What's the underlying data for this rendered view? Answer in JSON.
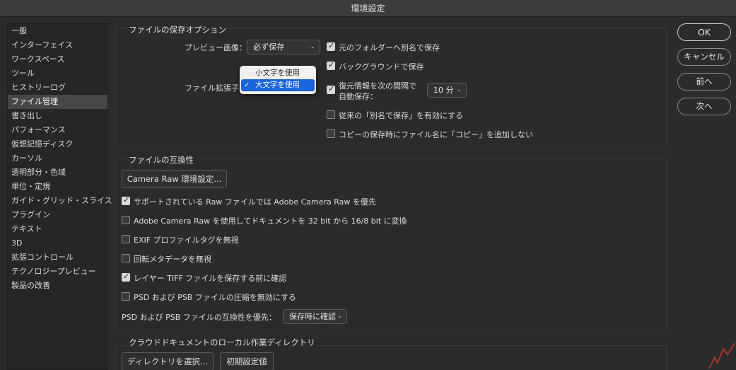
{
  "window": {
    "title": "環境設定"
  },
  "sidebar": {
    "items": [
      {
        "label": "一般"
      },
      {
        "label": "インターフェイス"
      },
      {
        "label": "ワークスペース"
      },
      {
        "label": "ツール"
      },
      {
        "label": "ヒストリーログ"
      },
      {
        "label": "ファイル管理",
        "selected": true
      },
      {
        "label": "書き出し"
      },
      {
        "label": "パフォーマンス"
      },
      {
        "label": "仮想記憶ディスク"
      },
      {
        "label": "カーソル"
      },
      {
        "label": "透明部分・色域"
      },
      {
        "label": "単位・定規"
      },
      {
        "label": "ガイド・グリッド・スライス"
      },
      {
        "label": "プラグイン"
      },
      {
        "label": "テキスト"
      },
      {
        "label": "3D"
      },
      {
        "label": "拡張コントロール"
      },
      {
        "label": "テクノロジープレビュー"
      },
      {
        "label": "製品の改善"
      }
    ]
  },
  "save_options": {
    "title": "ファイルの保存オプション",
    "preview_label": "プレビュー画像：",
    "preview_value": "必ず保存",
    "extension_label": "ファイル拡張子",
    "extension_menu": [
      {
        "label": "小文字を使用",
        "selected": false
      },
      {
        "label": "大文字を使用",
        "selected": true
      }
    ],
    "save_to_original_folder": {
      "label": "元のフォルダーへ別名で保存",
      "checked": true
    },
    "background_save": {
      "label": "バックグラウンドで保存",
      "checked": true
    },
    "auto_recover_line1": "復元情報を次の間隔で",
    "auto_recover_line2": "自動保存：",
    "auto_recover_checked": true,
    "auto_recover_interval": "10 分",
    "legacy_save_as": {
      "label": "従来の「別名で保存」を有効にする",
      "checked": false
    },
    "no_copy_suffix": {
      "label": "コピーの保存時にファイル名に「コピー」を追加しない",
      "checked": false
    }
  },
  "compatibility": {
    "title": "ファイルの互換性",
    "camera_raw_button": "Camera Raw 環境設定...",
    "options": [
      {
        "label": "サポートされている Raw ファイルでは Adobe Camera Raw を優先",
        "checked": true
      },
      {
        "label": "Adobe Camera Raw を使用してドキュメントを 32 bit から 16/8 bit に変換",
        "checked": false
      },
      {
        "label": "EXIF プロファイルタグを無視",
        "checked": false
      },
      {
        "label": "回転メタデータを無視",
        "checked": false
      },
      {
        "label": "レイヤー TIFF ファイルを保存する前に確認",
        "checked": true
      },
      {
        "label": "PSD および PSB ファイルの圧縮を無効にする",
        "checked": false
      }
    ],
    "psd_compat_label": "PSD および PSB ファイルの互換性を優先：",
    "psd_compat_value": "保存時に確認"
  },
  "cloud": {
    "title": "クラウドドキュメントのローカル作業ディレクトリ",
    "choose_button": "ディレクトリを選択...",
    "default_button": "初期設定値"
  },
  "buttons": {
    "ok": "OK",
    "cancel": "キャンセル",
    "prev": "前へ",
    "next": "次へ"
  },
  "colors": {
    "background": "#2b2b2b",
    "selection_blue": "#1b64da"
  }
}
